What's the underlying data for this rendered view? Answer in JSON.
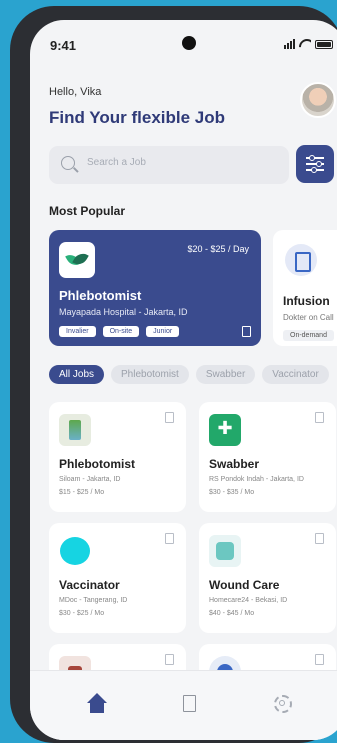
{
  "status": {
    "time": "9:41"
  },
  "header": {
    "greeting": "Hello, Vika",
    "title": "Find Your flexible Job"
  },
  "search": {
    "placeholder": "Search a Job"
  },
  "popular": {
    "heading": "Most Popular",
    "cards": [
      {
        "name": "Phlebotomist",
        "location": "Mayapada Hospital - Jakarta, ID",
        "price": "$20 - $25 / Day",
        "tags": [
          "Invalier",
          "On-site",
          "Junior"
        ]
      },
      {
        "name": "Infusion",
        "location": "Dokter on Call",
        "tags": [
          "On-demand"
        ]
      }
    ]
  },
  "filters": [
    "All Jobs",
    "Phlebotomist",
    "Swabber",
    "Vaccinator"
  ],
  "jobs": [
    {
      "name": "Phlebotomist",
      "location": "Siloam - Jakarta, ID",
      "salary": "$15 - $25 / Mo"
    },
    {
      "name": "Swabber",
      "location": "RS Pondok Indah - Jakarta, ID",
      "salary": "$30 - $35 / Mo"
    },
    {
      "name": "Vaccinator",
      "location": "MDoc - Tangerang, ID",
      "salary": "$30 - $25 / Mo"
    },
    {
      "name": "Wound Care",
      "location": "Homecare24 - Bekasi, ID",
      "salary": "$40 - $45 / Mo"
    }
  ],
  "colors": {
    "primary": "#3a4b8e",
    "background": "#f3f4f6",
    "frame": "#2aa3cf"
  },
  "nav": {
    "icons": [
      "home-icon",
      "bookmark-icon",
      "gear-icon"
    ],
    "active": "home"
  }
}
